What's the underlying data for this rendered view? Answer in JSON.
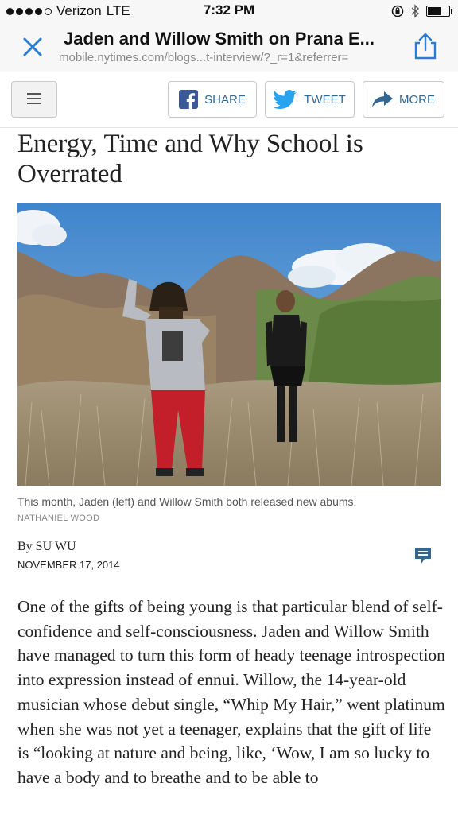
{
  "status_bar": {
    "carrier": "Verizon",
    "network": "LTE",
    "time": "7:32 PM",
    "icons": [
      "orientation-lock-icon",
      "bluetooth-icon",
      "battery-icon"
    ]
  },
  "browser": {
    "title": "Jaden and Willow Smith on Prana E...",
    "url": "mobile.nytimes.com/blogs...t-interview/?_r=1&referrer=",
    "close_icon": "close-icon",
    "share_icon": "share-icon",
    "accent_color": "#2a7dd1"
  },
  "toolbar": {
    "share_label": "SHARE",
    "tweet_label": "TWEET",
    "more_label": "MORE",
    "facebook_color": "#3b5998",
    "twitter_color": "#2aa3ef",
    "label_color": "#326891"
  },
  "article": {
    "headline": "Energy, Time and Why School is Overrated",
    "caption": "This month, Jaden (left) and Willow Smith both released new abums.",
    "credit": "NATHANIEL WOOD",
    "byline": "By SU WU",
    "date": "NOVEMBER 17, 2014",
    "body": "One of the gifts of being young is that particular blend of self-confidence and self-consciousness. Jaden and Willow Smith have managed to turn this form of heady teenage introspection into expression instead of ennui. Willow, the 14-year-old musician whose debut single, “Whip My Hair,” went platinum when she was not yet a teenager, explains that the gift of life is “looking at nature and being, like, ‘Wow, I am so lucky to have a body and to breathe and to be able to"
  }
}
